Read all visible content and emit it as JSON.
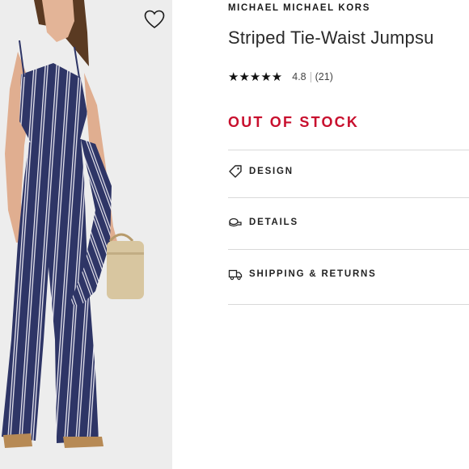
{
  "product": {
    "brand": "MICHAEL MICHAEL KORS",
    "title": "Striped Tie-Waist Jumpsu",
    "rating": {
      "stars": "★★★★★",
      "value": "4.8",
      "count": "(21)"
    },
    "stock_status": "OUT OF STOCK"
  },
  "accordion": [
    {
      "label": "DESIGN",
      "icon": "tag-icon"
    },
    {
      "label": "DETAILS",
      "icon": "fabric-icon"
    },
    {
      "label": "SHIPPING & RETURNS",
      "icon": "truck-icon"
    }
  ],
  "colors": {
    "stock": "#c8102e",
    "jumpsuit": "#2e3566",
    "stripe": "#e8e6ef",
    "bag": "#d8c6a0"
  },
  "icons": {
    "wishlist": "heart-icon"
  }
}
